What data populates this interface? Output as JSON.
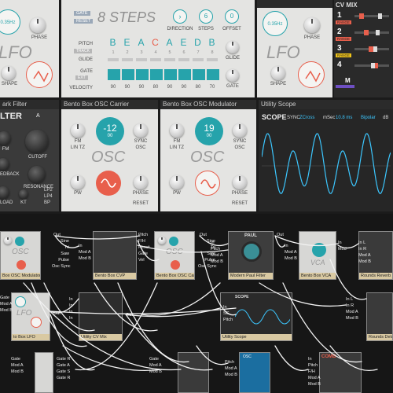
{
  "lfo_top": {
    "rate_value": "0.35Hz",
    "phase_label": "PHASE",
    "title": "LFO",
    "shape_label": "SHAPE"
  },
  "steps": {
    "gate_label": "GATE",
    "reset_label": "RESET",
    "title": "8 STEPS",
    "direction_label": "DIRECTION",
    "steps_label": "STEPS",
    "steps_value": "6",
    "offset_label": "OFFSET",
    "offset_value": "0",
    "pitch_label": "PITCH",
    "track_label": "TRACK",
    "glide_label": "GLIDE",
    "gate_row_label": "GATE",
    "ext_label": "EXT",
    "velocity_label": "VELOCITY",
    "notes": [
      "B",
      "E",
      "A",
      "C",
      "A",
      "E",
      "D",
      "B"
    ],
    "step_numbers": [
      "1",
      "2",
      "3",
      "4",
      "5",
      "6",
      "7",
      "8"
    ],
    "velocities": [
      "90",
      "90",
      "90",
      "80",
      "90",
      "90",
      "80",
      "70"
    ],
    "glide_knob_label": "GLIDE",
    "gate_knob_label": "GATE"
  },
  "lfo_top2": {
    "rate_value": "0.35Hz",
    "phase_label": "PHASE",
    "title": "LFO",
    "shape_label": "SHAPE"
  },
  "cvmix": {
    "title": "CV MIX",
    "rows": [
      "1",
      "2",
      "3",
      "4"
    ],
    "tags": [
      "RANGE",
      "RANGE",
      "RANGE",
      ""
    ],
    "m_label": "M"
  },
  "filter": {
    "header": "ark Filter",
    "title": "LTER",
    "ab": "A",
    "fm": "FM",
    "cutoff": "CUTOFF",
    "feedback": "EDBACK",
    "resonance": "RESONANCE",
    "load": "LOAD",
    "kt": "KT",
    "lp2": "LP2",
    "lp4": "LP4",
    "bp": "BP"
  },
  "osc_carrier": {
    "header": "Bento Box OSC Carrier",
    "value": "-12",
    "value_sub": "00",
    "fm_label": "FM",
    "lin_label": "LIN TZ",
    "sync_label": "SYNC",
    "osc_sub": "OSC",
    "title": "OSC",
    "pw_label": "PW",
    "phase_label": "PHASE",
    "reset_label": "RESET"
  },
  "osc_modulator": {
    "header": "Bento Box OSC Modulator",
    "value": "19",
    "value_sub": "00",
    "fm_label": "FM",
    "lin_label": "LIN TZ",
    "sync_label": "SYNC",
    "osc_sub": "OSC",
    "title": "OSC",
    "pw_label": "PW",
    "phase_label": "PHASE",
    "reset_label": "RESET"
  },
  "scope": {
    "header": "Utility Scope",
    "title": "SCOPE",
    "sync": "SYNC",
    "zcross": "ZCross",
    "msec_label": "mSec",
    "msec_value": "10.8 ms",
    "bipolar": "Bipolar",
    "db": "dB"
  },
  "rack": {
    "osc_mod_label": "Box OSC Modulator",
    "cvp_label": "Bento Box CVP",
    "osc_car_label": "Bento Box OSC Carrier",
    "paul_label": "Modern Paul Filter",
    "vca_label": "Bento Box VCA",
    "reverb_label": "Rounds Reverb",
    "lfo_label": "to Box LFO",
    "cvmix_label": "Utility CV Mix",
    "scope_label": "Utility Scope",
    "delay_label": "Rounds Delay",
    "paul_title": "PAUL",
    "scope_title": "SCOPE",
    "comb_title": "COMB",
    "osc_small": "OSC",
    "lfo_small": "LFO",
    "vca_small": "VCA",
    "port_out": "Out",
    "osc_ports": [
      "Sine",
      "Tri",
      "Saw",
      "Pulse",
      "Osc Sync"
    ],
    "in_ports": [
      "In",
      "Mod A",
      "Mod B"
    ],
    "cvp_ports": [
      "Pitch",
      "F/H",
      "Reset",
      "Gate",
      "Vel"
    ],
    "car_ports": [
      "Pitch",
      "FM",
      "Sync",
      "PW",
      "Mod B"
    ],
    "paul_ports": [
      "In",
      "Pitch",
      "Mod A",
      "Mod B"
    ],
    "vca_ports": [
      "In",
      "Mod"
    ],
    "reverb_ports": [
      "In L",
      "In R",
      "Mod A",
      "Mod B"
    ],
    "lfo_ports": [
      "Gate",
      "Mod A",
      "Mod B"
    ],
    "lfo_out": "Out",
    "cvmix_in": [
      "In",
      "In",
      "In",
      "In"
    ],
    "scope_ports": [
      "In",
      "SC",
      "Pitch"
    ],
    "delay_ports": [
      "In L",
      "In R",
      "Mod A",
      "Mod B"
    ],
    "bottom_ports1": [
      "Gate",
      "Mod A",
      "Mod B"
    ],
    "bottom_ports2": [
      "Gate R",
      "Gate A",
      "Gate S",
      "Gate R"
    ],
    "bottom_ports3": [
      "Gate",
      "Mod A",
      "Mod B"
    ],
    "bottom_ports4": [
      "Pitch",
      "Mod A",
      "Mod B"
    ],
    "bottom_ports5": [
      "In",
      "Pitch",
      "F/H",
      "Mod A",
      "Mod B"
    ]
  }
}
